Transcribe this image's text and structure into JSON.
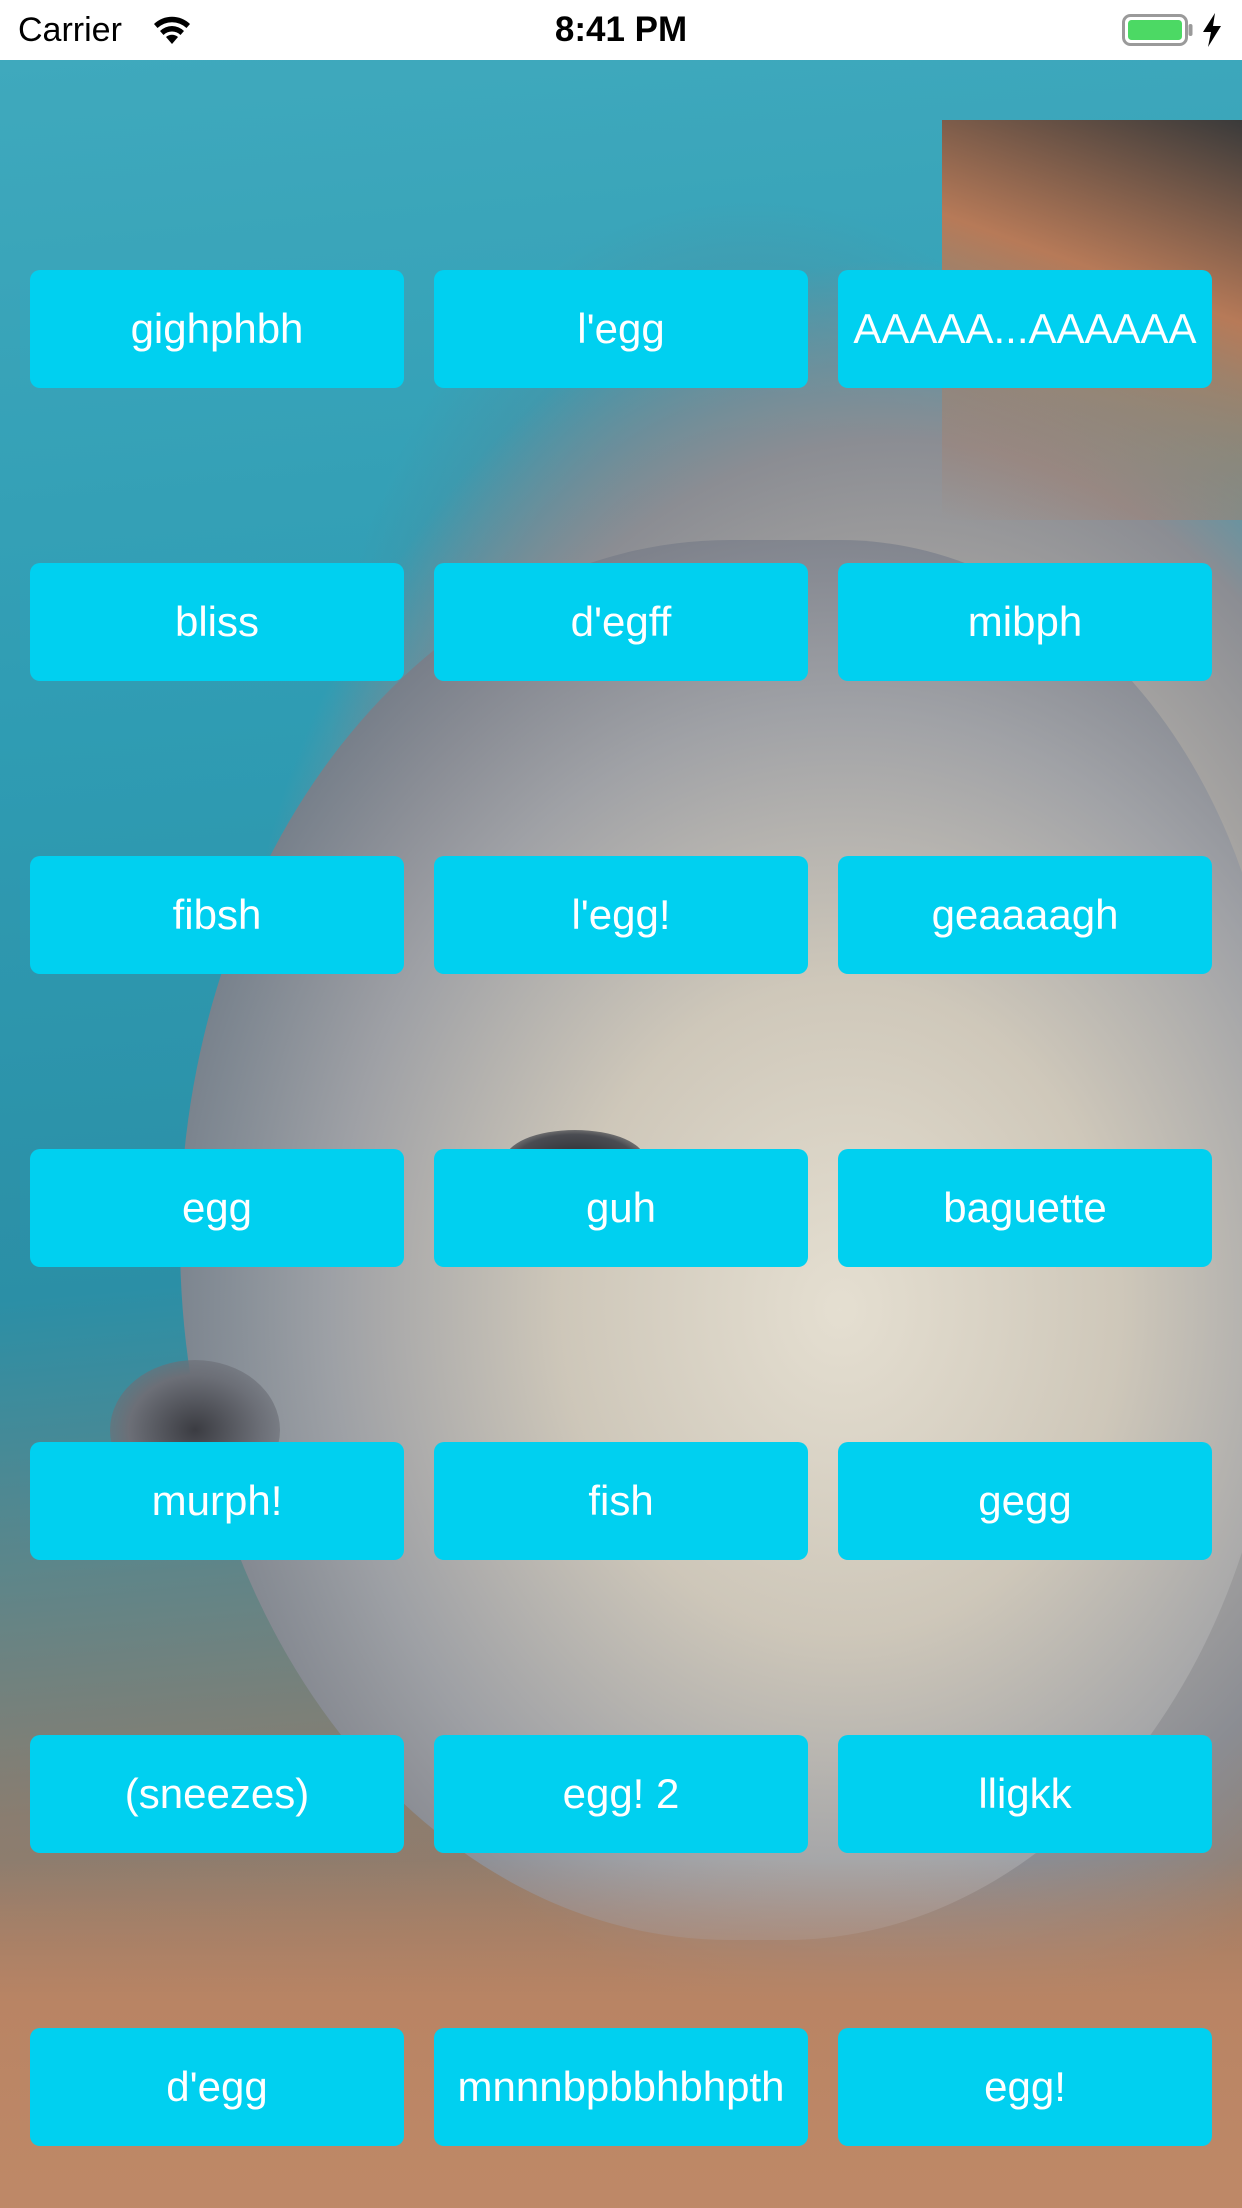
{
  "status_bar": {
    "carrier": "Carrier",
    "time": "8:41 PM",
    "battery_color": "#4cd964"
  },
  "colors": {
    "button_background": "#00d0f0",
    "button_text": "#ffffff"
  },
  "buttons": [
    {
      "label": "gighphbh"
    },
    {
      "label": "l'egg"
    },
    {
      "label": "AAAAA...AAAAAA"
    },
    {
      "label": "bliss"
    },
    {
      "label": "d'egff"
    },
    {
      "label": "mibph"
    },
    {
      "label": "fibsh"
    },
    {
      "label": "l'egg!"
    },
    {
      "label": "geaaaagh"
    },
    {
      "label": "egg"
    },
    {
      "label": "guh"
    },
    {
      "label": "baguette"
    },
    {
      "label": "murph!"
    },
    {
      "label": "fish"
    },
    {
      "label": "gegg"
    },
    {
      "label": "(sneezes)"
    },
    {
      "label": "egg! 2"
    },
    {
      "label": "lligkk"
    },
    {
      "label": "d'egg"
    },
    {
      "label": "mnnnbpbbhbhpth"
    },
    {
      "label": "egg!"
    }
  ],
  "background": {
    "icon": "seal-photo"
  }
}
